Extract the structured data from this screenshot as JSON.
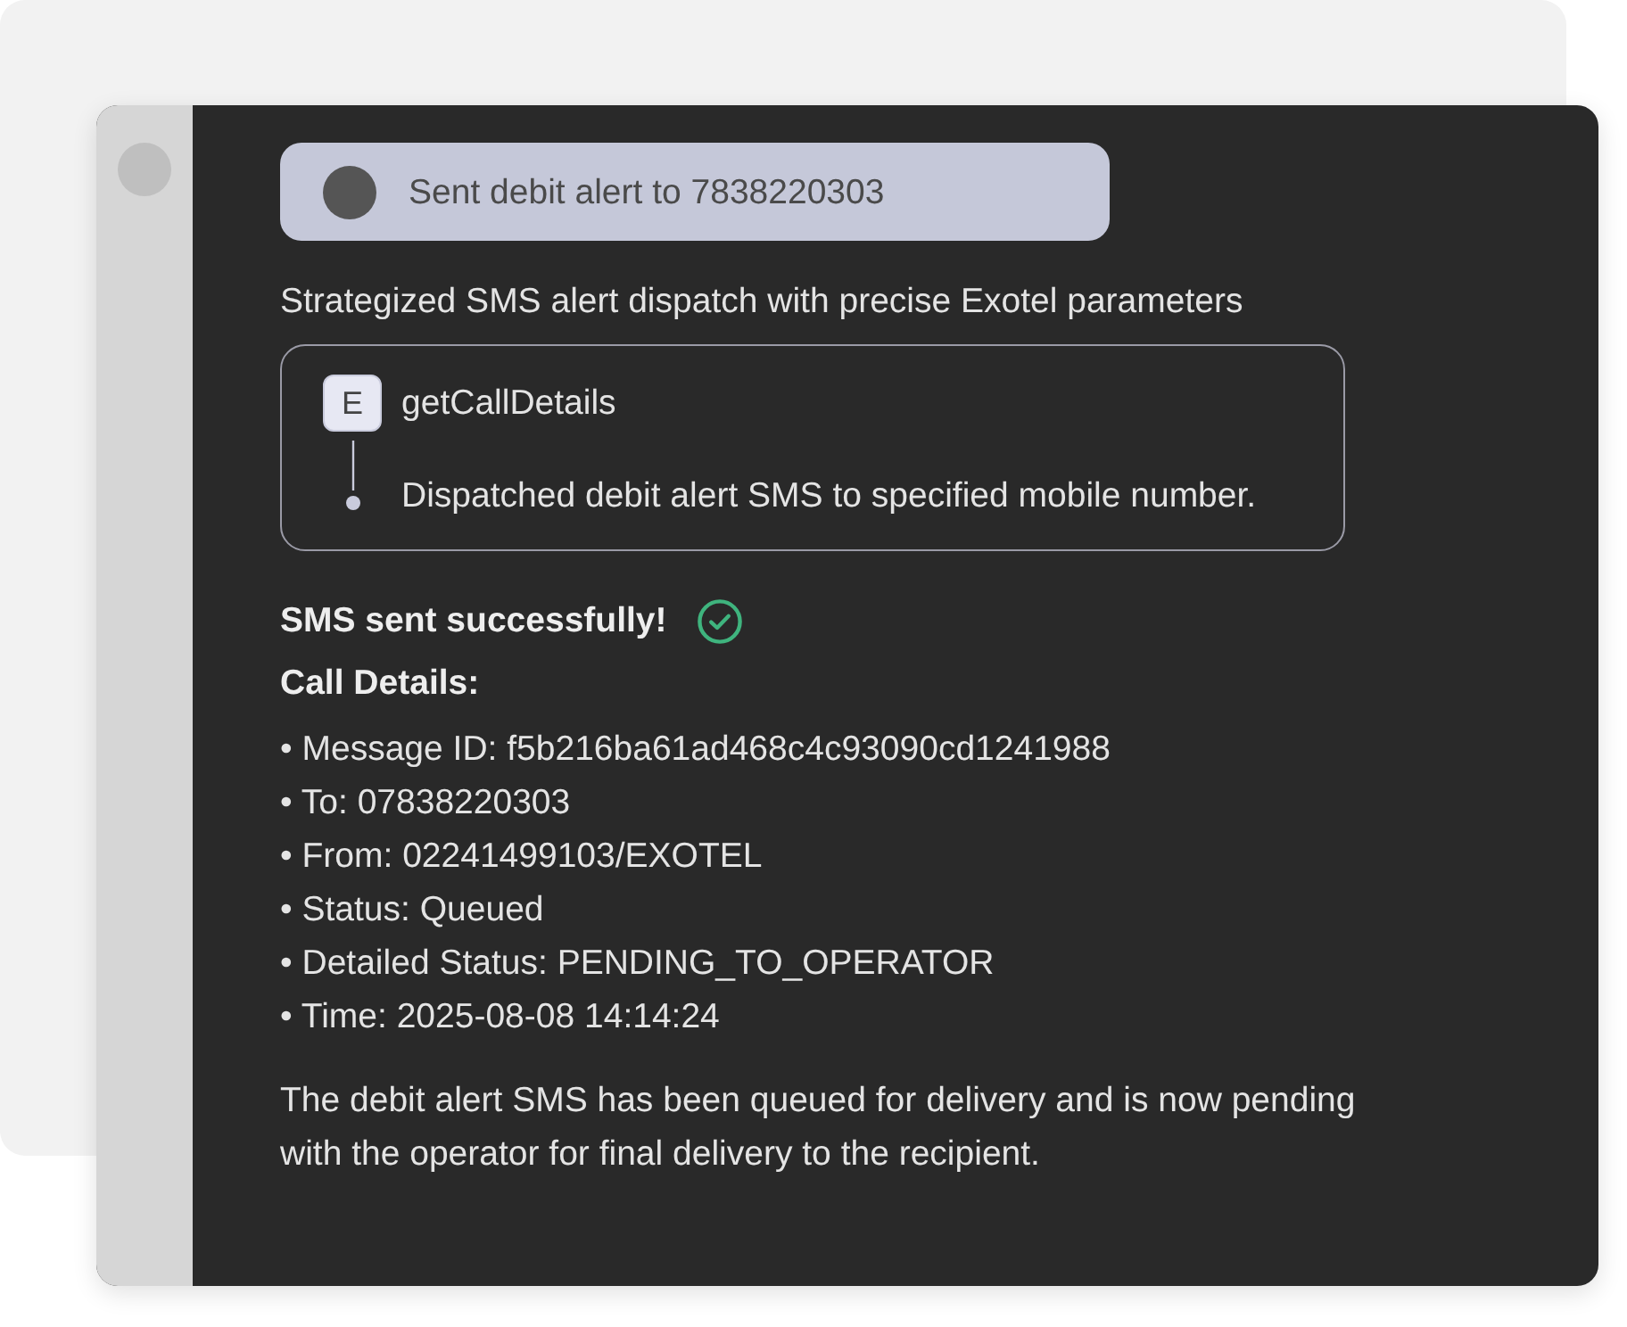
{
  "notice": {
    "text": "Sent debit alert to 7838220303"
  },
  "summary": "Strategized SMS alert dispatch with precise Exotel parameters",
  "tool_call": {
    "badge": "E",
    "name": "getCallDetails",
    "steps": [
      {
        "text": "Dispatched debit alert SMS to specified mobile number."
      }
    ]
  },
  "result": {
    "heading": "SMS sent successfully!",
    "details_heading": "Call Details:",
    "details": [
      "• Message ID: f5b216ba61ad468c4c93090cd1241988",
      "• To: 07838220303",
      "• From: 02241499103/EXOTEL",
      "• Status: Queued",
      "• Detailed Status: PENDING_TO_OPERATOR",
      "• Time: 2025-08-08 14:14:24"
    ]
  },
  "closing": "The debit alert SMS has been queued for delivery and is now pending with the operator for final delivery to the recipient."
}
